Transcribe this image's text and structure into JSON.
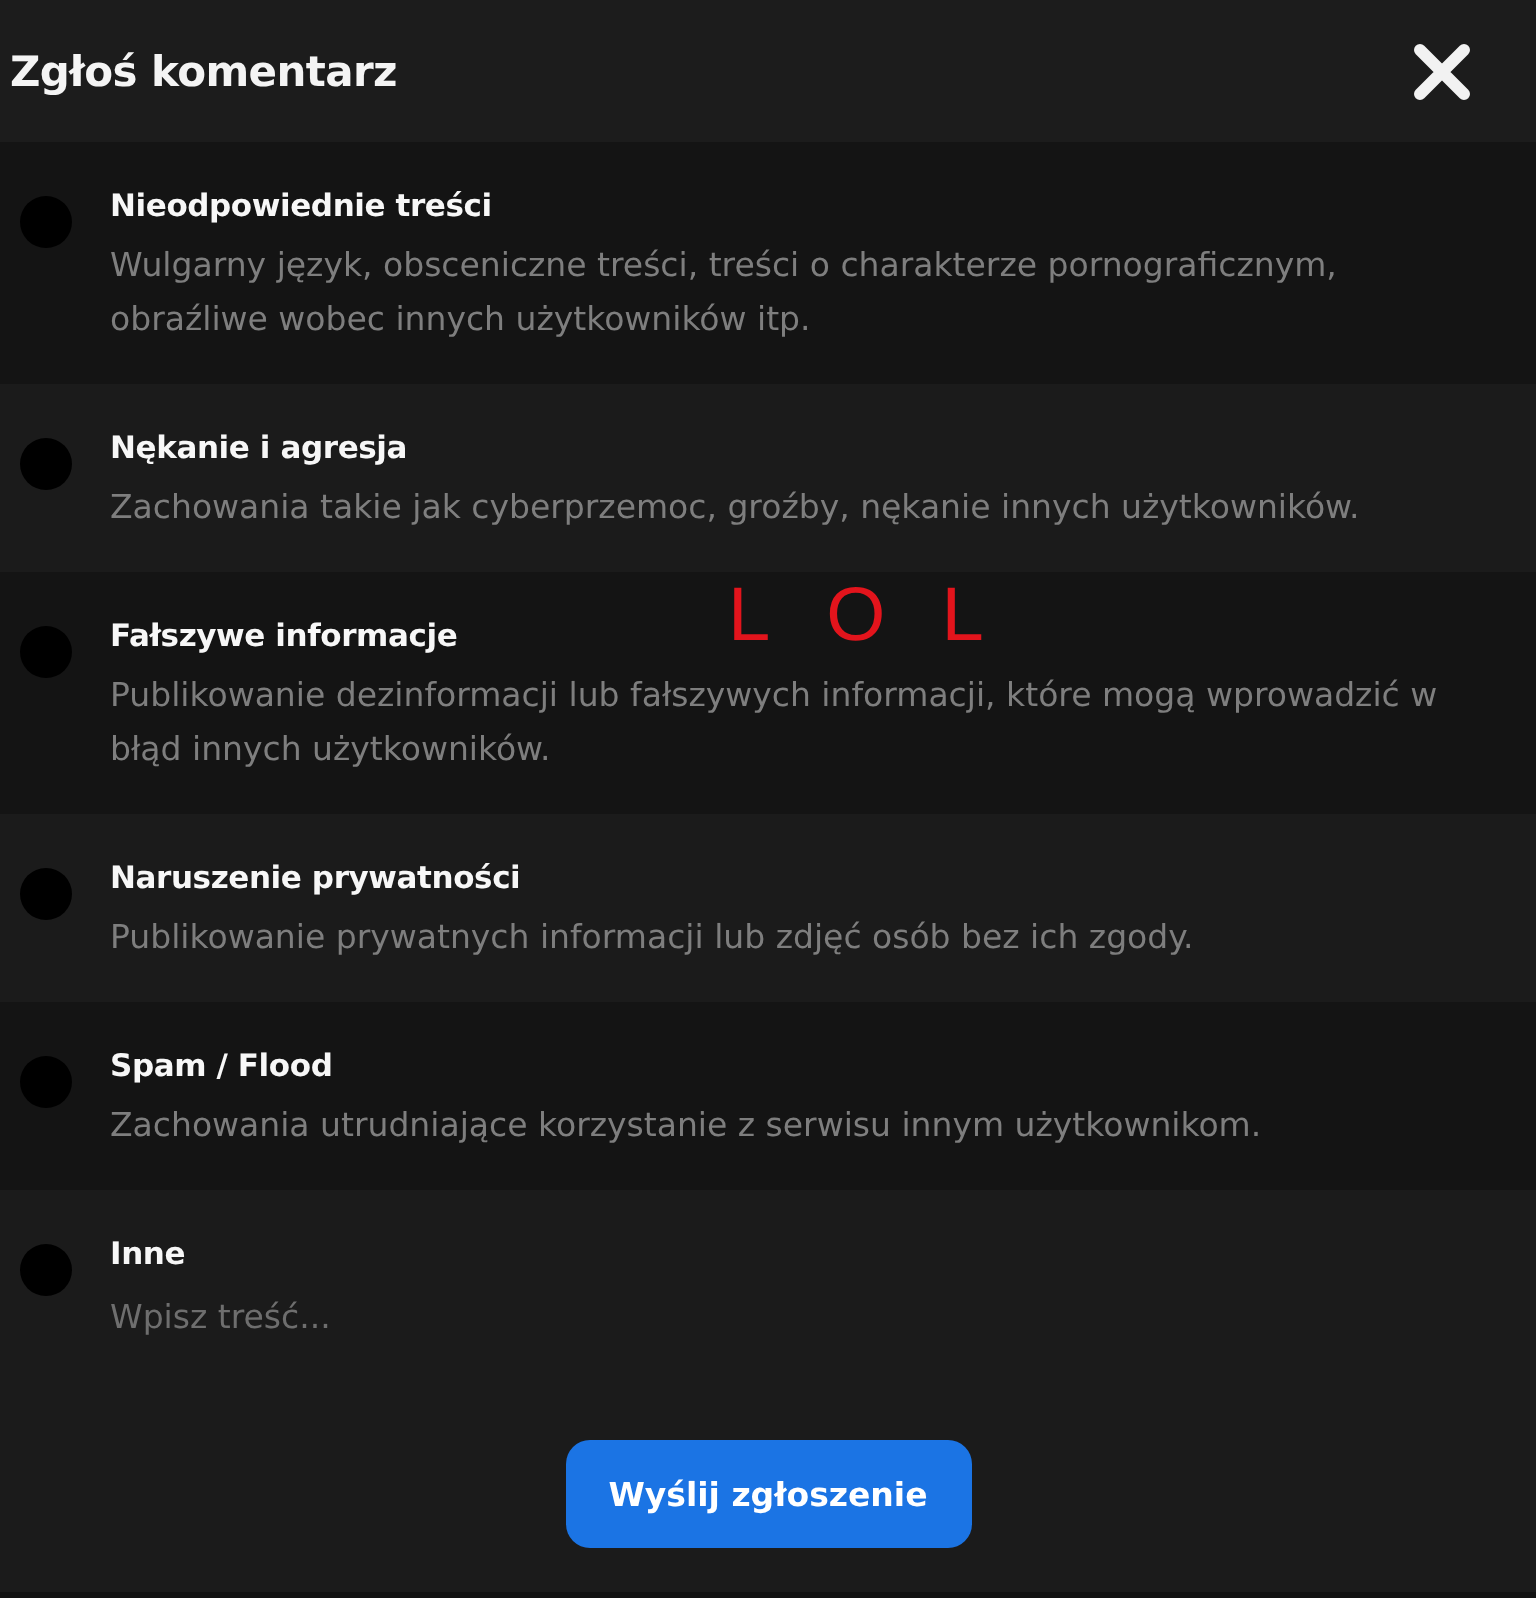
{
  "dialog": {
    "title": "Zgłoś komentarz"
  },
  "options": [
    {
      "kind": "description",
      "label": "Nieodpowiednie treści",
      "description": "Wulgarny język, obsceniczne treści, treści o charakterze pornograficznym, obraźliwe wobec innych użytkowników itp.",
      "selected": false
    },
    {
      "kind": "description",
      "label": "Nękanie i agresja",
      "description": "Zachowania takie jak cyberprzemoc, groźby, nękanie innych użytkowników.",
      "selected": false
    },
    {
      "kind": "description",
      "label": "Fałszywe informacje",
      "description": "Publikowanie dezinformacji lub fałszywych informacji, które mogą wprowadzić w błąd innych użytkowników.",
      "selected": false
    },
    {
      "kind": "description",
      "label": "Naruszenie prywatności",
      "description": "Publikowanie prywatnych informacji lub zdjęć osób bez ich zgody.",
      "selected": false
    },
    {
      "kind": "description",
      "label": "Spam / Flood",
      "description": "Zachowania utrudniające korzystanie z serwisu innym użytkownikom.",
      "selected": false
    },
    {
      "kind": "text_input",
      "label": "Inne",
      "placeholder": "Wpisz treść...",
      "selected": false
    }
  ],
  "annotation": {
    "text": "LOL"
  },
  "submit_button": {
    "label": "Wyślij zgłoszenie"
  }
}
